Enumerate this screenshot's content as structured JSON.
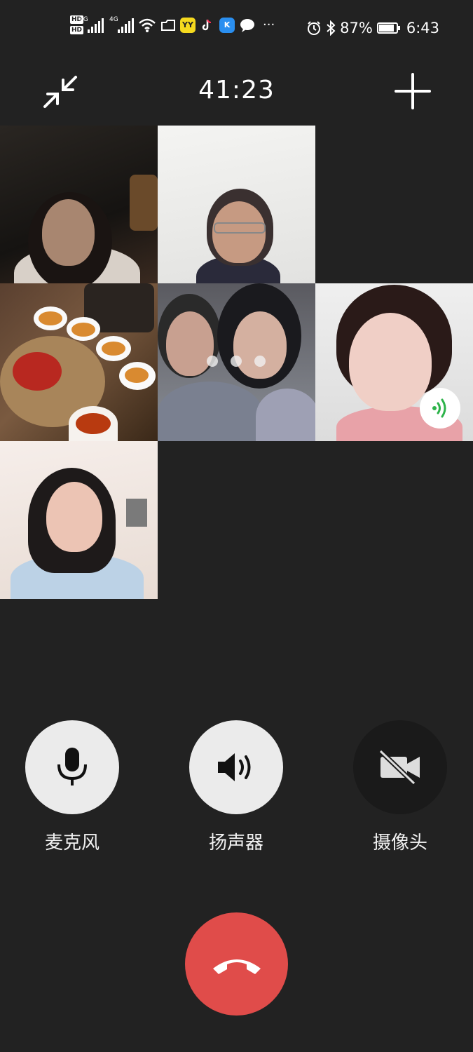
{
  "status_bar": {
    "hd1": "HD",
    "hd2": "HD",
    "net1": "4G",
    "net2": "4G",
    "yy_app": "YY",
    "k_app": "K",
    "more": "···",
    "battery_percent": "87%",
    "time": "6:43"
  },
  "call": {
    "timer": "41:23"
  },
  "controls": {
    "mic_label": "麦克风",
    "speaker_label": "扬声器",
    "camera_label": "摄像头"
  },
  "colors": {
    "background": "#222222",
    "button_active": "#ebebeb",
    "button_inactive": "#1a1a1a",
    "hangup": "#e04c4a",
    "speaking_indicator": "#2db34a"
  }
}
